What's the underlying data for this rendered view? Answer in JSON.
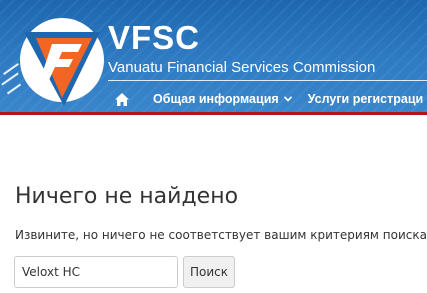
{
  "header": {
    "logo_text": "VFSC",
    "subtitle": "Vanuatu Financial Services Commission"
  },
  "nav": {
    "home_icon": "home-icon",
    "items": [
      {
        "label": "Общая информация",
        "has_dropdown": true
      },
      {
        "label": "Услуги регистраци",
        "has_dropdown": false
      }
    ]
  },
  "main": {
    "title": "Ничего не найдено",
    "message": "Извините, но ничего не соответствует вашим критериям поиска. П",
    "search": {
      "value": "Veloxt HC",
      "button_label": "Поиск"
    }
  },
  "colors": {
    "header_blue": "#2f7bc4",
    "accent_red": "#b3121b",
    "logo_orange": "#f26522"
  }
}
